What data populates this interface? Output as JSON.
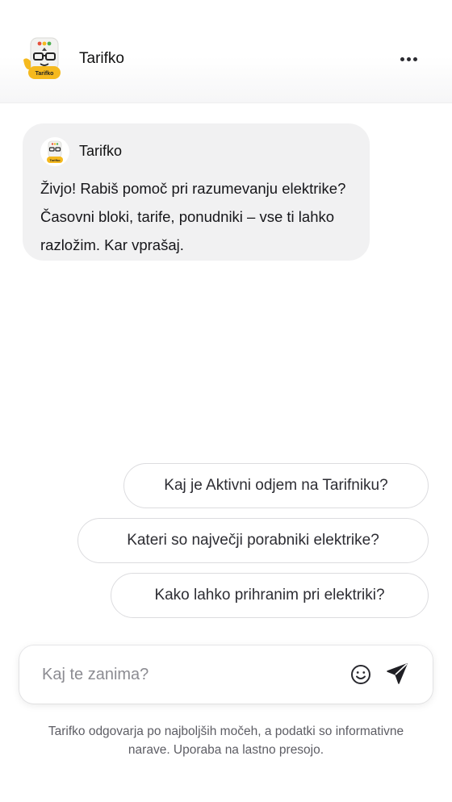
{
  "header": {
    "title": "Tarifko",
    "menu_icon": "more-horizontal-icon",
    "avatar_badge": "Tarifko"
  },
  "message": {
    "sender": "Tarifko",
    "text": "Živjo! Rabiš pomoč pri razumevanju elek­trike? Časovni bloki, tarife, ponudniki – vse ti lahko razložim. Kar vprašaj.",
    "avatar_badge": "Tarifko"
  },
  "suggestions": [
    "Kaj je Aktivni odjem na Tarifniku?",
    "Kateri so največji porabniki elektrike?",
    "Kako lahko prihranim pri elektriki?"
  ],
  "composer": {
    "placeholder": "Kaj te zanima?",
    "emoji_icon": "smiley-icon",
    "send_icon": "send-icon"
  },
  "disclaimer": "Tarifko odgovarja po najboljših močeh, a podatki so informativne narave. Uporaba na lastno presojo.",
  "colors": {
    "badge": "#f5b91e",
    "bubble": "#f1f1f2",
    "accent_dots": [
      "#e6503c",
      "#f5b91e",
      "#4caf50"
    ]
  }
}
